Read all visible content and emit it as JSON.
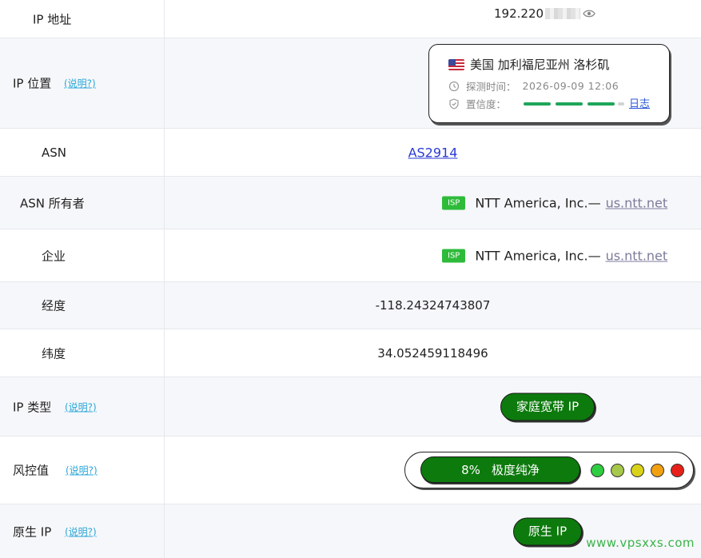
{
  "rows": {
    "ip": {
      "label": "IP 地址",
      "value": "192.220"
    },
    "location": {
      "label": "IP 位置",
      "help": "(说明?)",
      "place": "美国 加利福尼亚州 洛杉矶",
      "time_label": "探测时间：",
      "time_value": "2026-09-09 12:06",
      "confidence_label": "置信度：",
      "confidence_level": 0.9,
      "log_link": "日志"
    },
    "asn": {
      "label": "ASN",
      "value": "AS2914"
    },
    "asn_owner": {
      "label": "ASN 所有者",
      "badge": "ISP",
      "name": "NTT America, Inc.—",
      "link": "us.ntt.net"
    },
    "company": {
      "label": "企业",
      "badge": "ISP",
      "name": "NTT America, Inc.—",
      "link": "us.ntt.net"
    },
    "longitude": {
      "label": "经度",
      "value": "-118.24324743807"
    },
    "latitude": {
      "label": "纬度",
      "value": "34.052459118496"
    },
    "ip_type": {
      "label": "IP 类型",
      "help": "(说明?)",
      "value": "家庭宽带 IP"
    },
    "risk": {
      "label": "风控值",
      "help": "(说明?)",
      "percent": "8%",
      "text": "极度纯净",
      "dot_colors": [
        "#2ecc40",
        "#a6c84a",
        "#d9d21a",
        "#f0a010",
        "#e8201a"
      ]
    },
    "native": {
      "label": "原生 IP",
      "help": "(说明?)",
      "value": "原生 IP"
    }
  },
  "colors": {
    "accent_green": "#0d7a0d",
    "isp_badge": "#2ebb3a",
    "help_link": "#2aa7d8"
  },
  "watermark": "www.vpsxxs.com"
}
